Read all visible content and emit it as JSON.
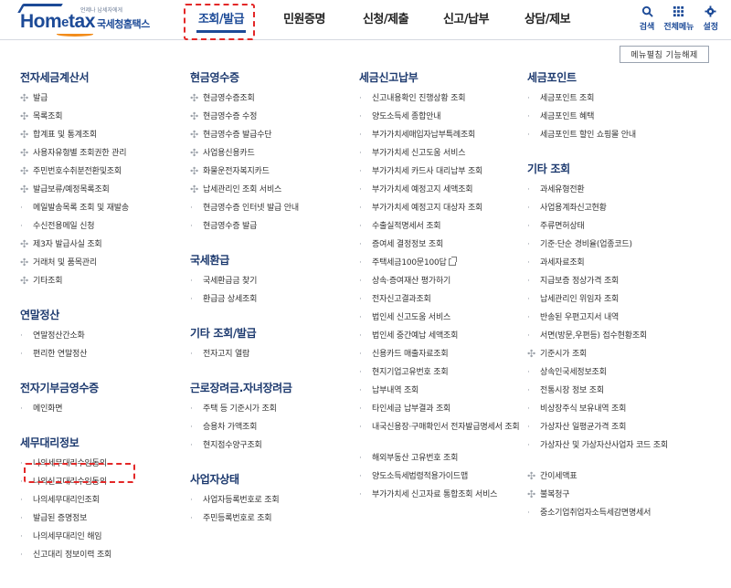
{
  "header": {
    "logo": {
      "brand_left": "Hom",
      "brand_e": "e",
      "brand_right": "tax",
      "tagline": "언제나 납세자에게",
      "subtitle": "국세청홈택스"
    },
    "nav": [
      {
        "label": "조회/발급",
        "active": true
      },
      {
        "label": "민원증명"
      },
      {
        "label": "신청/제출"
      },
      {
        "label": "신고/납부"
      },
      {
        "label": "상담/제보"
      }
    ],
    "tools": {
      "search": "검색",
      "all_menu": "전체메뉴",
      "settings": "설정"
    },
    "menu_fold_button": "메뉴펼침 기능해제",
    "accent_color": "#1c4a97",
    "highlight_color": "#e32727"
  },
  "columns": {
    "c1": [
      {
        "title": "전자세금계산서",
        "items": [
          {
            "label": "발급",
            "marker": "plus"
          },
          {
            "label": "목록조회",
            "marker": "plus"
          },
          {
            "label": "합계표 및 통계조회",
            "marker": "plus"
          },
          {
            "label": "사용자유형별 조회권한 관리",
            "marker": "plus"
          },
          {
            "label": "주민번호수취분전환및조회",
            "marker": "plus"
          },
          {
            "label": "발급보류/예정목록조회",
            "marker": "plus"
          },
          {
            "label": "메일발송목록 조회 및 재발송",
            "marker": "dot"
          },
          {
            "label": "수신전용메일 신청",
            "marker": "dot"
          },
          {
            "label": "제3자 발급사실 조회",
            "marker": "plus"
          },
          {
            "label": "거래처 및 품목관리",
            "marker": "plus"
          },
          {
            "label": "기타조회",
            "marker": "plus"
          }
        ]
      },
      {
        "title": "연말정산",
        "items": [
          {
            "label": "연말정산간소화",
            "marker": "dot"
          },
          {
            "label": "편리한 연말정산",
            "marker": "dot"
          }
        ]
      },
      {
        "title": "전자기부금영수증",
        "items": [
          {
            "label": "메인화면",
            "marker": "dot"
          }
        ]
      },
      {
        "title": "세무대리정보",
        "items": [
          {
            "label": "나의세무대리수임동의",
            "marker": "dot",
            "highlight": true
          },
          {
            "label": "나의신고대리수임동의",
            "marker": "dot"
          },
          {
            "label": "나의세무대리인조회",
            "marker": "dot"
          },
          {
            "label": "발급된 증명정보",
            "marker": "dot"
          },
          {
            "label": "나의세무대리인 해임",
            "marker": "dot"
          },
          {
            "label": "신고대리 정보이력 조회",
            "marker": "dot"
          }
        ]
      }
    ],
    "c2": [
      {
        "title": "현금영수증",
        "items": [
          {
            "label": "현금영수증조회",
            "marker": "plus"
          },
          {
            "label": "현금영수증 수정",
            "marker": "plus"
          },
          {
            "label": "현금영수증 발급수단",
            "marker": "plus"
          },
          {
            "label": "사업용신용카드",
            "marker": "plus"
          },
          {
            "label": "화물운전자복지카드",
            "marker": "plus"
          },
          {
            "label": "납세관리인 조회 서비스",
            "marker": "plus"
          },
          {
            "label": "현금영수증 인터넷 발급 안내",
            "marker": "dot"
          },
          {
            "label": "현금영수증 발급",
            "marker": "dot"
          }
        ]
      },
      {
        "title": "국세환급",
        "items": [
          {
            "label": "국세환급금 찾기",
            "marker": "dot"
          },
          {
            "label": "환급금 상세조회",
            "marker": "dot"
          }
        ]
      },
      {
        "title": "기타 조회/발급",
        "items": [
          {
            "label": "전자고지 열람",
            "marker": "dot"
          }
        ]
      },
      {
        "title": "근로장려금.자녀장려금",
        "items": [
          {
            "label": "주택 등 기준시가 조회",
            "marker": "dot"
          },
          {
            "label": "승용차 가액조회",
            "marker": "dot"
          },
          {
            "label": "현지점수양구조회",
            "marker": "dot"
          }
        ]
      },
      {
        "title": "사업자상태",
        "items": [
          {
            "label": "사업자등록번호로 조회",
            "marker": "dot"
          },
          {
            "label": "주민등록번호로 조회",
            "marker": "dot"
          }
        ]
      }
    ],
    "c3": [
      {
        "title": "세금신고납부",
        "items": [
          {
            "label": "신고내용확인 진행상황 조회",
            "marker": "dot"
          },
          {
            "label": "양도소득세 종합안내",
            "marker": "dot"
          },
          {
            "label": "부가가치세매입자납부특례조회",
            "marker": "dot"
          },
          {
            "label": "부가가치세 신고도움 서비스",
            "marker": "dot"
          },
          {
            "label": "부가가치세 카드사 대리납부 조회",
            "marker": "dot"
          },
          {
            "label": "부가가치세 예정고지 세액조회",
            "marker": "dot"
          },
          {
            "label": "부가가치세 예정고지 대상자 조회",
            "marker": "dot"
          },
          {
            "label": "수출실적명세서 조회",
            "marker": "dot"
          },
          {
            "label": "증여세 결정정보 조회",
            "marker": "dot"
          },
          {
            "label": "주택세금100문100답",
            "marker": "dot",
            "external": true
          },
          {
            "label": "상속·증여재산 평가하기",
            "marker": "dot"
          },
          {
            "label": "전자신고결과조회",
            "marker": "dot"
          },
          {
            "label": "법인세 신고도움 서비스",
            "marker": "dot"
          },
          {
            "label": "법인세 중간예납 세액조회",
            "marker": "dot"
          },
          {
            "label": "신용카드 매출자료조회",
            "marker": "dot"
          },
          {
            "label": "현지기업고유번호 조회",
            "marker": "dot"
          },
          {
            "label": "납부내역 조회",
            "marker": "dot"
          },
          {
            "label": "타인세금 납부결과 조회",
            "marker": "dot"
          },
          {
            "label": "내국신용장·구매확인서 전자발급명세서 조회",
            "marker": "dot",
            "tall": true
          },
          {
            "label": "해외부동산 고유번호 조회",
            "marker": "dot"
          },
          {
            "label": "양도소득세법령적용가이드맵",
            "marker": "dot"
          },
          {
            "label": "부가가치세 신고자료 통합조회 서비스",
            "marker": "dot"
          }
        ]
      }
    ],
    "c4": [
      {
        "title": "세금포인트",
        "items": [
          {
            "label": "세금포인트 조회",
            "marker": "dot"
          },
          {
            "label": "세금포인트 혜택",
            "marker": "dot"
          },
          {
            "label": "세금포인트 할인 쇼핑몰 안내",
            "marker": "dot"
          }
        ]
      },
      {
        "title": "기타 조회",
        "items": [
          {
            "label": "과세유형전환",
            "marker": "dot"
          },
          {
            "label": "사업용계좌신고현황",
            "marker": "dot"
          },
          {
            "label": "주류면허상태",
            "marker": "dot"
          },
          {
            "label": "기준·단순 경비율(업종코드)",
            "marker": "dot"
          },
          {
            "label": "과세자료조회",
            "marker": "dot"
          },
          {
            "label": "지급보증 정상가격 조회",
            "marker": "dot"
          },
          {
            "label": "납세관리인 위임자 조회",
            "marker": "dot"
          },
          {
            "label": "반송된 우편고지서 내역",
            "marker": "dot"
          },
          {
            "label": "서면(방문,우편등) 접수현황조회",
            "marker": "dot"
          },
          {
            "label": "기준시가 조회",
            "marker": "plus"
          },
          {
            "label": "상속인국세정보조회",
            "marker": "dot"
          },
          {
            "label": "전통시장 정보 조회",
            "marker": "dot"
          },
          {
            "label": "비상장주식 보유내역 조회",
            "marker": "dot"
          },
          {
            "label": "가상자산 일평균가격 조회",
            "marker": "dot"
          },
          {
            "label": "가상자산 및 가상자산사업자 코드 조회",
            "marker": "dot",
            "tall": true
          },
          {
            "label": "간이세액표",
            "marker": "plus"
          },
          {
            "label": "불복청구",
            "marker": "plus"
          },
          {
            "label": "중소기업취업자소득세감면명세서",
            "marker": "dot"
          }
        ]
      }
    ]
  }
}
